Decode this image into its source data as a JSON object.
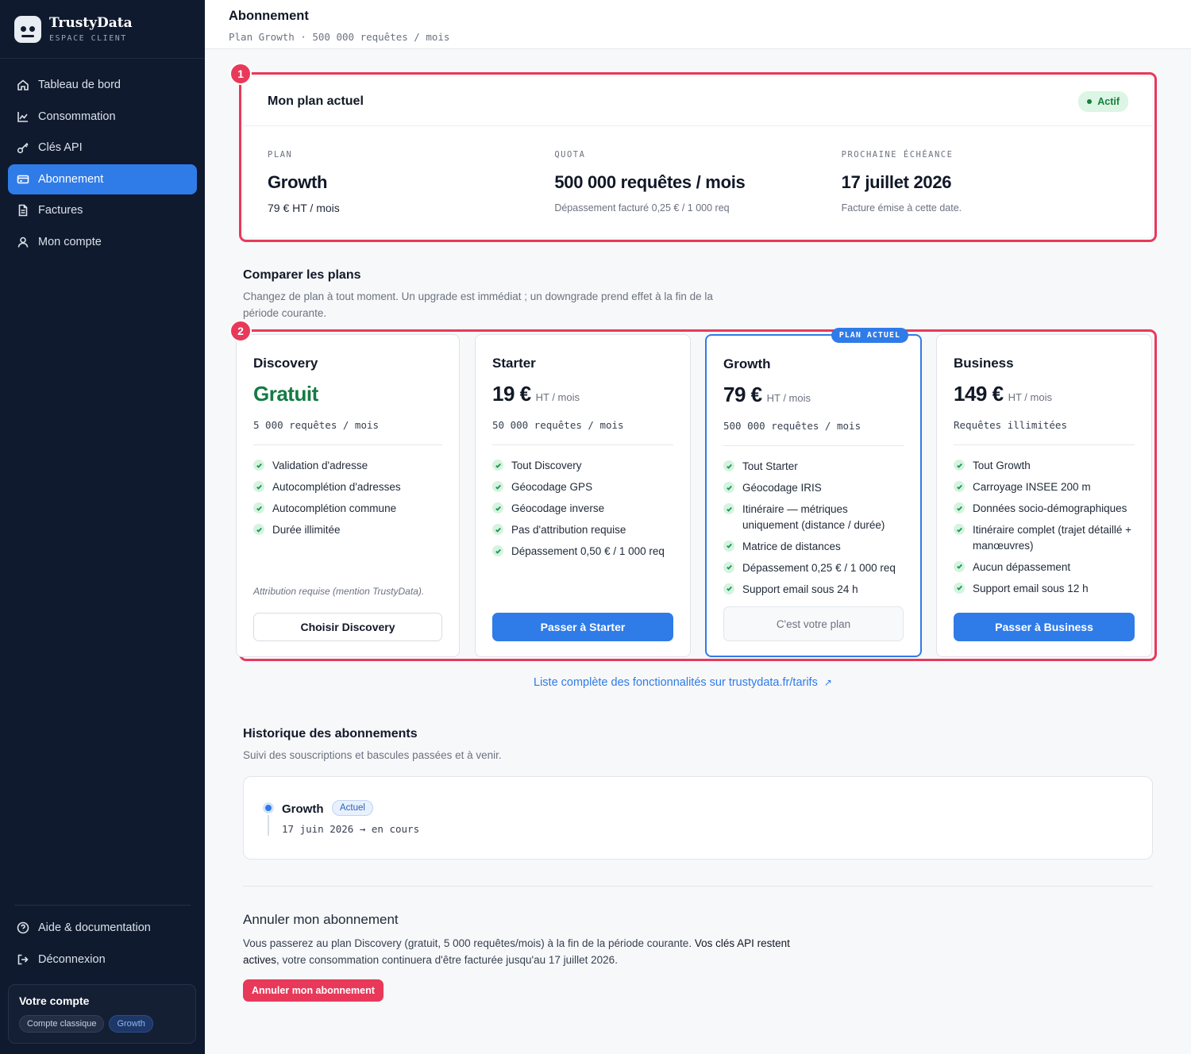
{
  "brand": {
    "name": "TrustyData",
    "subtitle": "ESPACE CLIENT"
  },
  "sidebar": {
    "items": [
      {
        "label": "Tableau de bord",
        "icon": "home-icon"
      },
      {
        "label": "Consommation",
        "icon": "chart-line-icon"
      },
      {
        "label": "Clés API",
        "icon": "key-icon"
      },
      {
        "label": "Abonnement",
        "icon": "credit-card-icon",
        "active": true
      },
      {
        "label": "Factures",
        "icon": "document-icon"
      },
      {
        "label": "Mon compte",
        "icon": "user-icon"
      }
    ],
    "bottom_items": [
      {
        "label": "Aide & documentation",
        "icon": "help-circle-icon"
      },
      {
        "label": "Déconnexion",
        "icon": "logout-icon"
      }
    ],
    "account": {
      "title": "Votre compte",
      "tags": [
        "Compte classique",
        "Growth"
      ]
    }
  },
  "header": {
    "title": "Abonnement",
    "subtitle": "Plan Growth · 500 000 requêtes / mois"
  },
  "markers": [
    "1",
    "2"
  ],
  "current_plan": {
    "title": "Mon plan actuel",
    "status": "Actif",
    "columns": [
      {
        "label": "PLAN",
        "value": "Growth",
        "note": "79 € HT / mois"
      },
      {
        "label": "QUOTA",
        "value": "500 000 requêtes / mois",
        "note": "Dépassement facturé 0,25 € / 1 000 req"
      },
      {
        "label": "PROCHAINE ÉCHÉANCE",
        "value": "17 juillet 2026",
        "note": "Facture émise à cette date."
      }
    ]
  },
  "compare": {
    "title": "Comparer les plans",
    "description": "Changez de plan à tout moment. Un upgrade est immédiat ; un downgrade prend effet à la fin de la période courante.",
    "plans": [
      {
        "name": "Discovery",
        "price": "Gratuit",
        "unit": "",
        "quota": "5 000 requêtes / mois",
        "features": [
          "Validation d'adresse",
          "Autocomplétion d'adresses",
          "Autocomplétion commune",
          "Durée illimitée"
        ],
        "note": "Attribution requise (mention TrustyData).",
        "button": "Choisir Discovery"
      },
      {
        "name": "Starter",
        "price": "19 €",
        "unit": "HT / mois",
        "quota": "50 000 requêtes / mois",
        "features": [
          "Tout Discovery",
          "Géocodage GPS",
          "Géocodage inverse",
          "Pas d'attribution requise",
          "Dépassement 0,50 € / 1 000 req"
        ],
        "button": "Passer à Starter"
      },
      {
        "name": "Growth",
        "price": "79 €",
        "unit": "HT / mois",
        "quota": "500 000 requêtes / mois",
        "ribbon": "PLAN ACTUEL",
        "features": [
          "Tout Starter",
          "Géocodage IRIS",
          "Itinéraire — métriques uniquement (distance / durée)",
          "Matrice de distances",
          "Dépassement 0,25 € / 1 000 req",
          "Support email sous 24 h"
        ],
        "button": "C'est votre plan"
      },
      {
        "name": "Business",
        "price": "149 €",
        "unit": "HT / mois",
        "quota": "Requêtes illimitées",
        "features": [
          "Tout Growth",
          "Carroyage INSEE 200 m",
          "Données socio-démographiques",
          "Itinéraire complet (trajet détaillé + manœuvres)",
          "Aucun dépassement",
          "Support email sous 12 h"
        ],
        "button": "Passer à Business"
      }
    ],
    "link": "Liste complète des fonctionnalités sur trustydata.fr/tarifs",
    "link_icon": "↗"
  },
  "history": {
    "title": "Historique des abonnements",
    "description": "Suivi des souscriptions et bascules passées et à venir.",
    "entries": [
      {
        "plan": "Growth",
        "badge": "Actuel",
        "dates": "17 juin 2026 → en cours"
      }
    ]
  },
  "cancel": {
    "title": "Annuler mon abonnement",
    "text_before": "Vous passerez au plan Discovery (gratuit, 5 000 requêtes/mois) à la fin de la période courante. ",
    "text_bold": "Vos clés API restent actives",
    "text_after": ", votre consommation continuera d'être facturée jusqu'au 17 juillet 2026.",
    "button": "Annuler mon abonnement"
  },
  "colors": {
    "accent": "#2f7be8",
    "sidebar_bg": "#0f1a2e",
    "danger": "#e8395a",
    "success": "#15803d"
  }
}
